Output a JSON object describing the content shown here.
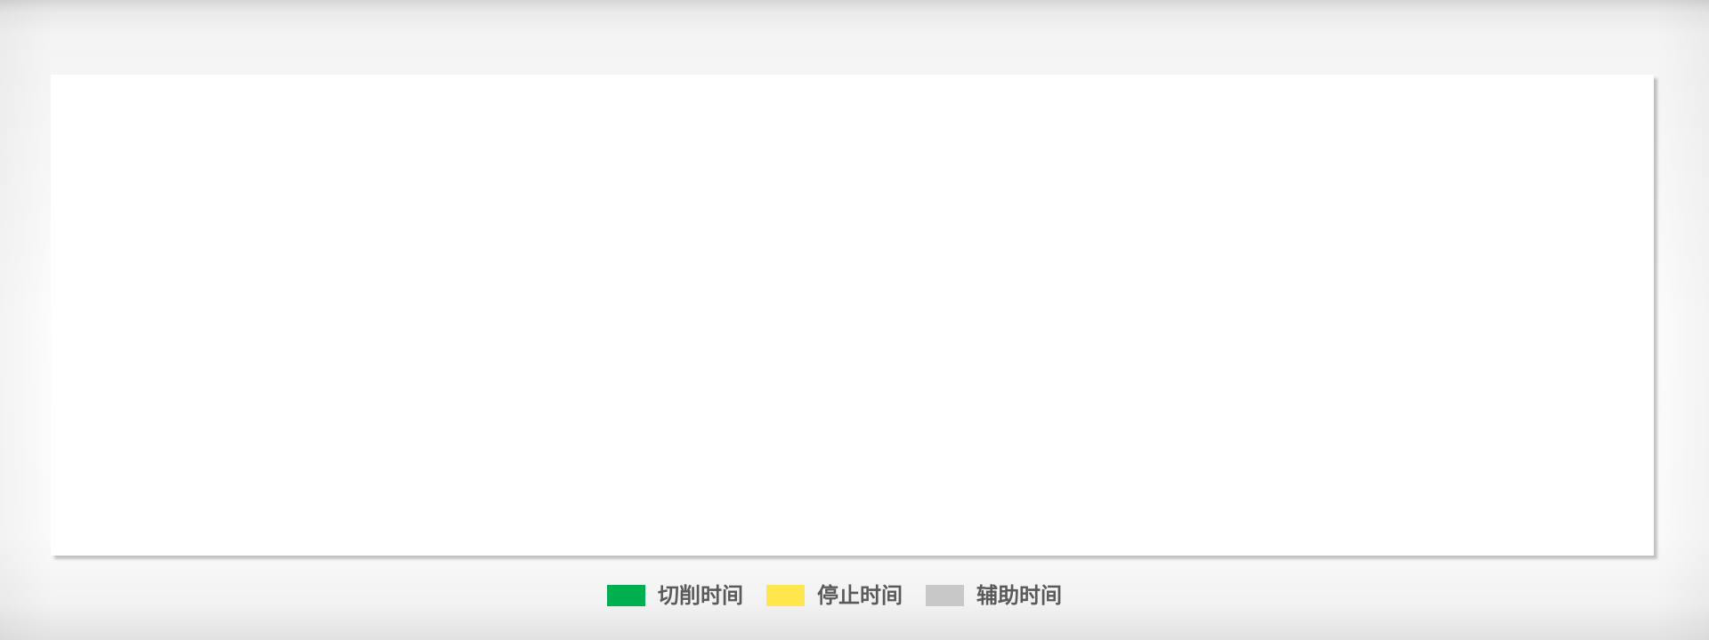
{
  "legend": {
    "items": [
      {
        "label": "切削时间",
        "color": "#00b050"
      },
      {
        "label": "停止时间",
        "color": "#ffe74d"
      },
      {
        "label": "辅助时间",
        "color": "#c8c8c8"
      }
    ]
  }
}
